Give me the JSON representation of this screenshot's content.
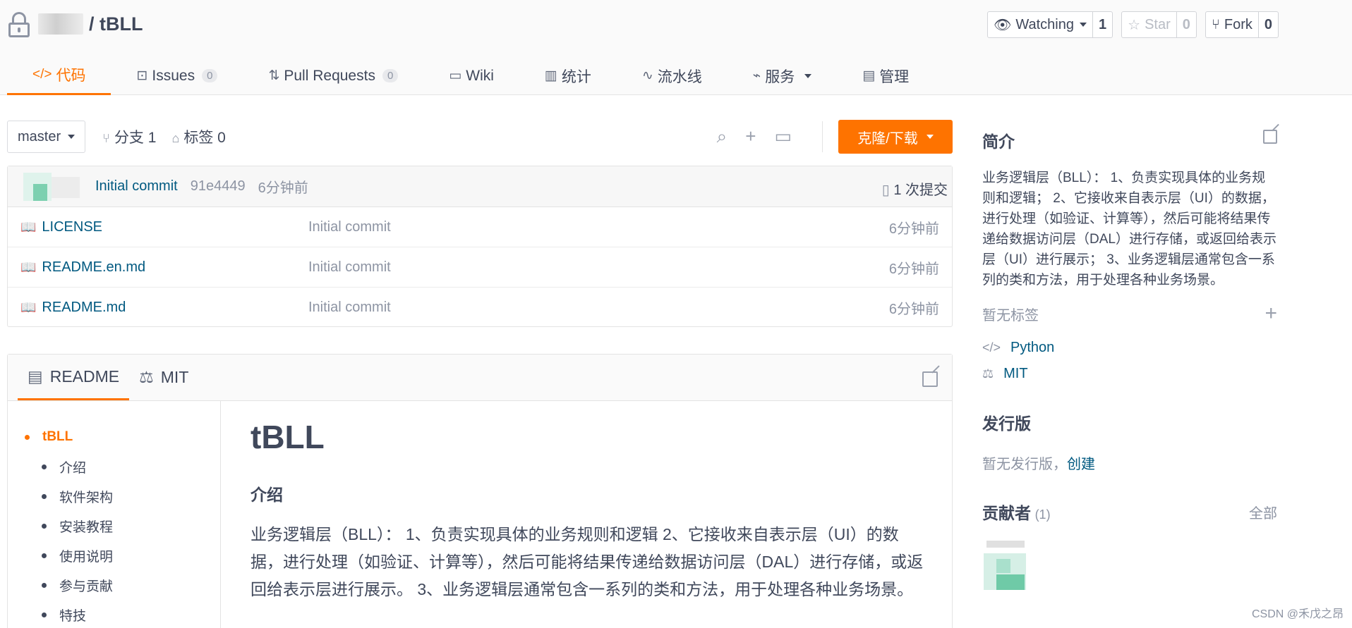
{
  "repo": {
    "path": "/ tBLL"
  },
  "actions": {
    "watch": {
      "label": "Watching",
      "count": "1"
    },
    "star": {
      "label": "Star",
      "count": "0"
    },
    "fork": {
      "label": "Fork",
      "count": "0"
    }
  },
  "tabs": [
    {
      "label": "代码",
      "icon": "</>"
    },
    {
      "label": "Issues",
      "badge": "0"
    },
    {
      "label": "Pull Requests",
      "badge": "0"
    },
    {
      "label": "Wiki"
    },
    {
      "label": "统计"
    },
    {
      "label": "流水线"
    },
    {
      "label": "服务"
    },
    {
      "label": "管理"
    }
  ],
  "branch": {
    "current": "master",
    "branches": "分支 1",
    "tags": "标签 0"
  },
  "clone_label": "克隆/下载",
  "commit": {
    "message": "Initial commit",
    "sha": "91e4449",
    "time": "6分钟前",
    "count": "1 次提交"
  },
  "files": [
    {
      "name": "LICENSE",
      "commit": "Initial commit",
      "time": "6分钟前"
    },
    {
      "name": "README.en.md",
      "commit": "Initial commit",
      "time": "6分钟前"
    },
    {
      "name": "README.md",
      "commit": "Initial commit",
      "time": "6分钟前"
    }
  ],
  "readme": {
    "tabs": [
      "README",
      "MIT"
    ],
    "toc": [
      "tBLL",
      "介绍",
      "软件架构",
      "安装教程",
      "使用说明",
      "参与贡献",
      "特技"
    ],
    "title": "tBLL",
    "section": "介绍",
    "paragraph": "业务逻辑层（BLL）： 1、负责实现具体的业务规则和逻辑 2、它接收来自表示层（UI）的数据，进行处理（如验证、计算等），然后可能将结果传递给数据访问层（DAL）进行存储，或返回给表示层进行展示。 3、业务逻辑层通常包含一系列的类和方法，用于处理各种业务场景。"
  },
  "sidebar": {
    "intro_title": "简介",
    "intro_text": "业务逻辑层（BLL）： 1、负责实现具体的业务规则和逻辑； 2、它接收来自表示层（UI）的数据，进行处理（如验证、计算等），然后可能将结果传递给数据访问层（DAL）进行存储，或返回给表示层（UI）进行展示； 3、业务逻辑层通常包含一系列的类和方法，用于处理各种业务场景。",
    "no_tags": "暂无标签",
    "language": "Python",
    "license": "MIT",
    "release_title": "发行版",
    "no_release": "暂无发行版，",
    "create": "创建",
    "contrib_title": "贡献者",
    "contrib_count": "(1)",
    "all": "全部"
  },
  "watermark": "CSDN @禾戊之昂",
  "colors": {
    "accent": "#fe7300",
    "link": "#005980",
    "text": "#40485b"
  }
}
